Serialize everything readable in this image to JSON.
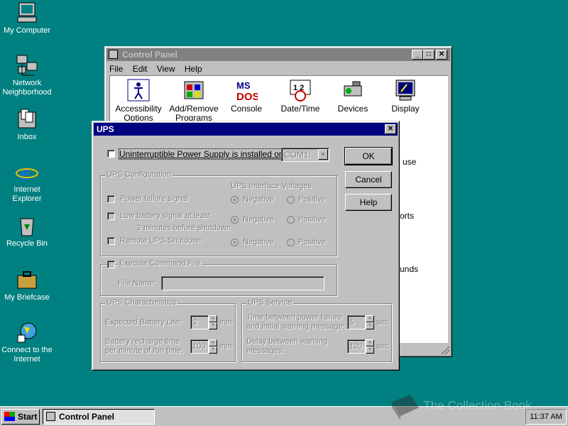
{
  "desktop": {
    "icons": [
      {
        "label": "My Computer",
        "icon": "computer-icon"
      },
      {
        "label": "Network Neighborhood",
        "icon": "network-icon"
      },
      {
        "label": "Inbox",
        "icon": "inbox-icon"
      },
      {
        "label": "Internet Explorer",
        "icon": "ie-icon"
      },
      {
        "label": "Recycle Bin",
        "icon": "recycle-bin-icon"
      },
      {
        "label": "My Briefcase",
        "icon": "briefcase-icon"
      },
      {
        "label": "Connect to the Internet",
        "icon": "connect-icon"
      }
    ]
  },
  "control_panel": {
    "title": "Control Panel",
    "menu": [
      "File",
      "Edit",
      "View",
      "Help"
    ],
    "items": [
      {
        "label": "Accessibility Options",
        "icon": "accessibility-icon"
      },
      {
        "label": "Add/Remove Programs",
        "icon": "add-remove-icon"
      },
      {
        "label": "Console",
        "icon": "console-icon"
      },
      {
        "label": "Date/Time",
        "icon": "datetime-icon"
      },
      {
        "label": "Devices",
        "icon": "devices-icon"
      },
      {
        "label": "Display",
        "icon": "display-icon"
      }
    ],
    "partial_labels": [
      "use",
      "orts",
      "unds"
    ]
  },
  "ups_dialog": {
    "title": "UPS",
    "installed_label": "Uninterruptible Power Supply is installed on:",
    "port_value": "COM1:",
    "buttons": {
      "ok": "OK",
      "cancel": "Cancel",
      "help": "Help"
    },
    "config": {
      "title": "UPS Configuration",
      "voltages_title": "UPS Interface Voltages:",
      "power_failure": "Power failure signal",
      "low_battery_1": "Low battery signal at least",
      "low_battery_2": "2 minutes before shutdown.",
      "remote_shutdown": "Remote UPS Shutdown",
      "negative": "Negative",
      "positive": "Positive"
    },
    "command": {
      "label": "Execute Command File",
      "file_name_label": "File Name:"
    },
    "characteristics": {
      "title": "UPS Characteristics",
      "battery_life_label": "Expected Battery Life:",
      "battery_life_value": "2",
      "recharge_label_1": "Battery recharge time",
      "recharge_label_2": "per minute of run time:",
      "recharge_value": "100",
      "unit": "min"
    },
    "service": {
      "title": "UPS Service",
      "warning_label_1": "Time between power failure",
      "warning_label_2": "and initial warning message:",
      "warning_value": "5",
      "delay_label_1": "Delay between warning",
      "delay_label_2": "messages:",
      "delay_value": "120",
      "unit": "sec"
    }
  },
  "taskbar": {
    "start": "Start",
    "task": "Control Panel",
    "clock": "11:37 AM"
  },
  "watermark": "The Collection Book"
}
